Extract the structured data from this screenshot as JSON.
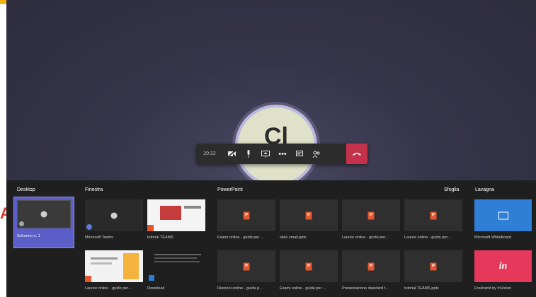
{
  "call": {
    "timer": "20:22",
    "avatar_initials": "Cl",
    "controls": [
      "camera-icon",
      "mic-icon",
      "share-screen-icon",
      "more-icon",
      "chat-icon",
      "participants-icon",
      "hangup-icon"
    ]
  },
  "sections": {
    "desktop": "Desktop",
    "window": "Finestra",
    "powerpoint": "PowerPoint",
    "browse": "Sfoglia",
    "whiteboard": "Lavagna"
  },
  "desktop_tile": {
    "label": "Schermo n. 1"
  },
  "window_tiles": [
    {
      "label": "Microsoft Teams"
    },
    {
      "label": "tutorial TEAMS"
    },
    {
      "label": "Lauree online - guide per..."
    },
    {
      "label": "Download"
    }
  ],
  "ppt_tiles": [
    {
      "label": "Esami online - guida per ..."
    },
    {
      "label": "slide smail.pptx"
    },
    {
      "label": "Lauree online - guida per..."
    },
    {
      "label": "Lauree online - guida per..."
    },
    {
      "label": "Riunioni online - guida p..."
    },
    {
      "label": "Esami online - guida per ..."
    },
    {
      "label": "Presentazione standard f..."
    },
    {
      "label": "tutorial TEAMS.pptx"
    }
  ],
  "whiteboard_tiles": [
    {
      "label": "Microsoft Whiteboard",
      "color": "#2f7fd6"
    },
    {
      "label": "Freehand by InVision",
      "color": "#e5385a"
    }
  ],
  "colors": {
    "accent": "#5b5fc7",
    "hangup": "#c4314b",
    "ppt": "#e3562e"
  }
}
